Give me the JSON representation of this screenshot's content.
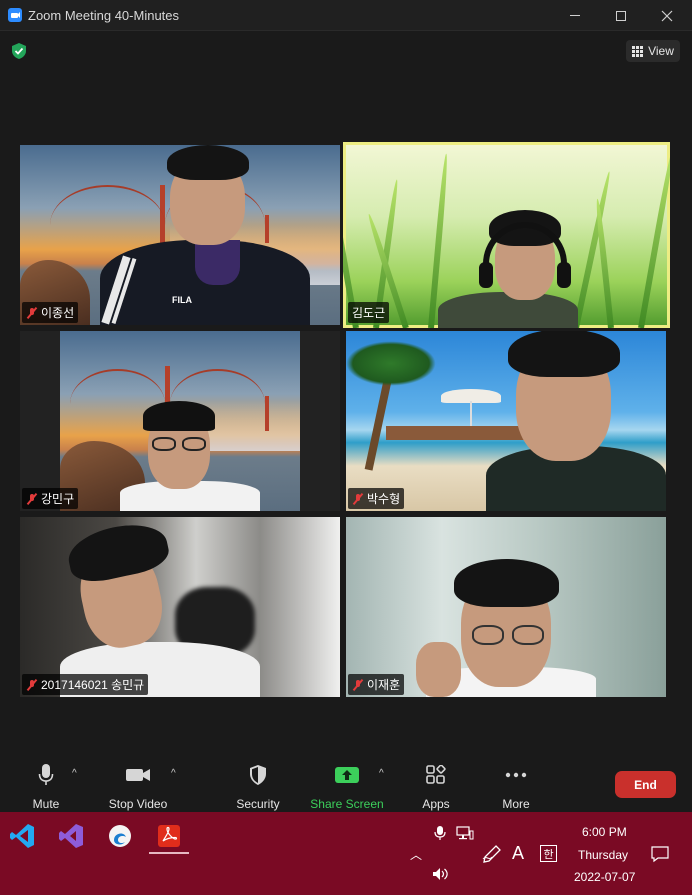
{
  "window": {
    "title": "Zoom Meeting 40-Minutes",
    "min_label": "minimize",
    "max_label": "maximize",
    "close_label": "close"
  },
  "meeting": {
    "view_label": "View",
    "participants": [
      {
        "name": "이종선",
        "muted": true,
        "active": false
      },
      {
        "name": "김도근",
        "muted": false,
        "active": true
      },
      {
        "name": "강민구",
        "muted": true,
        "active": false
      },
      {
        "name": "박수형",
        "muted": true,
        "active": false
      },
      {
        "name": "2017146021 송민규",
        "muted": true,
        "active": false
      },
      {
        "name": "이재훈",
        "muted": true,
        "active": false
      }
    ],
    "shirt_logo": "FILA"
  },
  "controls": {
    "mute": "Mute",
    "stop_video": "Stop Video",
    "security": "Security",
    "share_screen": "Share Screen",
    "apps": "Apps",
    "more": "More",
    "end": "End",
    "share_color": "#3ccf5b",
    "end_color": "#c9302c"
  },
  "taskbar": {
    "apps": [
      "vscode-icon",
      "visual-studio-icon",
      "edge-beta-icon",
      "acrobat-icon"
    ],
    "ime_label": "A",
    "ime_korean": "한",
    "time": "6:00 PM",
    "day": "Thursday",
    "date": "2022-07-07",
    "color": "#7a0a24"
  }
}
